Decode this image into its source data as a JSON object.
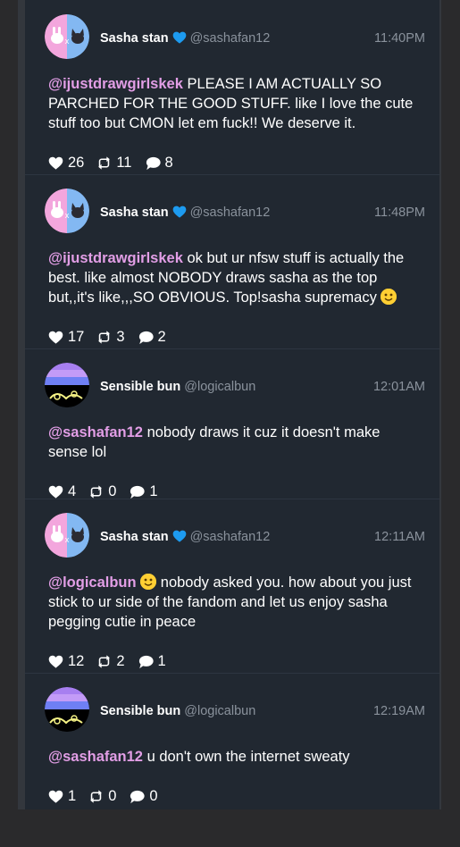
{
  "tweets": [
    {
      "name": "Sasha stan",
      "handle": "@sashafan12",
      "verified": true,
      "time": "11:40PM",
      "mention": "@ijustdrawgirlskek",
      "text": " PLEASE I AM ACTUALLY SO PARCHED FOR THE GOOD STUFF. like I love the cute stuff too but CMON let em fuck!! We deserve it.",
      "emoji_after_mention": false,
      "emoji_end": false,
      "likes": "26",
      "retweets": "11",
      "replies": "8"
    },
    {
      "name": "Sasha stan",
      "handle": "@sashafan12",
      "verified": true,
      "time": "11:48PM",
      "mention": "@ijustdrawgirlskek",
      "text": " ok but ur nfsw stuff is actually the best. like almost NOBODY draws sasha as the top but,,it's like,,,SO OBVIOUS. Top!sasha supremacy ",
      "emoji_after_mention": false,
      "emoji_end": true,
      "likes": "17",
      "retweets": "3",
      "replies": "2"
    },
    {
      "name": "Sensible bun",
      "handle": "@logicalbun",
      "verified": false,
      "time": "12:01AM",
      "mention": "@sashafan12",
      "text": " nobody draws it cuz it doesn't make sense lol",
      "emoji_after_mention": false,
      "emoji_end": false,
      "likes": "4",
      "retweets": "0",
      "replies": "1"
    },
    {
      "name": "Sasha stan",
      "handle": "@sashafan12",
      "verified": true,
      "time": "12:11AM",
      "mention": "@logicalbun",
      "text": " nobody asked you. how about you just stick to ur side of the fandom and let us enjoy sasha pegging cutie in peace",
      "emoji_after_mention": true,
      "emoji_end": false,
      "likes": "12",
      "retweets": "2",
      "replies": "1"
    },
    {
      "name": "Sensible bun",
      "handle": "@logicalbun",
      "verified": false,
      "time": "12:19AM",
      "mention": "@sashafan12",
      "text": " u don't own the internet sweaty",
      "emoji_after_mention": false,
      "emoji_end": false,
      "likes": "1",
      "retweets": "0",
      "replies": "0"
    }
  ],
  "colors": {
    "mention": "#e29ee6",
    "verified": "#1d9bf0",
    "avatar_pink": "#f3a6dd",
    "avatar_blue": "#83b8f2",
    "avatar_purple": "#a77ff0"
  },
  "icons": {
    "like": "heart-icon",
    "retweet": "retweet-icon",
    "reply": "speech-bubble-icon",
    "verified": "blue-heart-icon"
  }
}
